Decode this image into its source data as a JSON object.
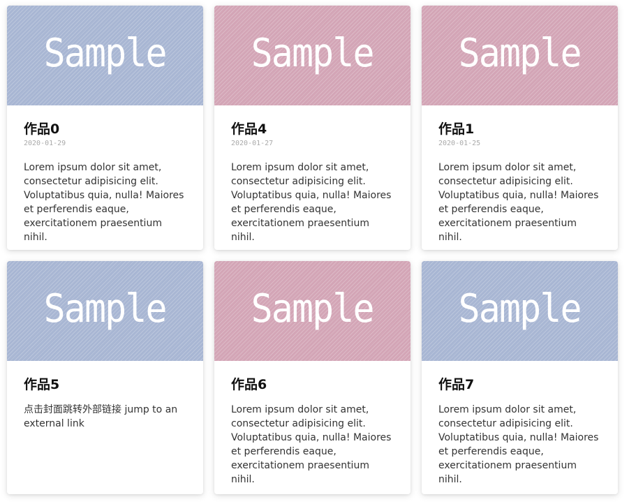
{
  "cards": [
    {
      "cover_text": "Sample",
      "cover_color": "#a8b6d3",
      "title": "作品0",
      "date": "2020-01-29",
      "desc": "Lorem ipsum dolor sit amet, consectetur adipisicing elit. Voluptatibus quia, nulla! Maiores et perferendis eaque, exercitationem praesentium nihil."
    },
    {
      "cover_text": "Sample",
      "cover_color": "#d3a5b6",
      "title": "作品4",
      "date": "2020-01-27",
      "desc": "Lorem ipsum dolor sit amet, consectetur adipisicing elit. Voluptatibus quia, nulla! Maiores et perferendis eaque, exercitationem praesentium nihil."
    },
    {
      "cover_text": "Sample",
      "cover_color": "#d3a5b6",
      "title": "作品1",
      "date": "2020-01-25",
      "desc": "Lorem ipsum dolor sit amet, consectetur adipisicing elit. Voluptatibus quia, nulla! Maiores et perferendis eaque, exercitationem praesentium nihil."
    },
    {
      "cover_text": "Sample",
      "cover_color": "#a8b6d3",
      "title": "作品5",
      "date": "",
      "desc": "点击封面跳转外部链接 jump to an external link"
    },
    {
      "cover_text": "Sample",
      "cover_color": "#d3a5b6",
      "title": "作品6",
      "date": "",
      "desc": "Lorem ipsum dolor sit amet, consectetur adipisicing elit. Voluptatibus quia, nulla! Maiores et perferendis eaque, exercitationem praesentium nihil."
    },
    {
      "cover_text": "Sample",
      "cover_color": "#a8b6d3",
      "title": "作品7",
      "date": "",
      "desc": "Lorem ipsum dolor sit amet, consectetur adipisicing elit. Voluptatibus quia, nulla! Maiores et perferendis eaque, exercitationem praesentium nihil."
    }
  ]
}
